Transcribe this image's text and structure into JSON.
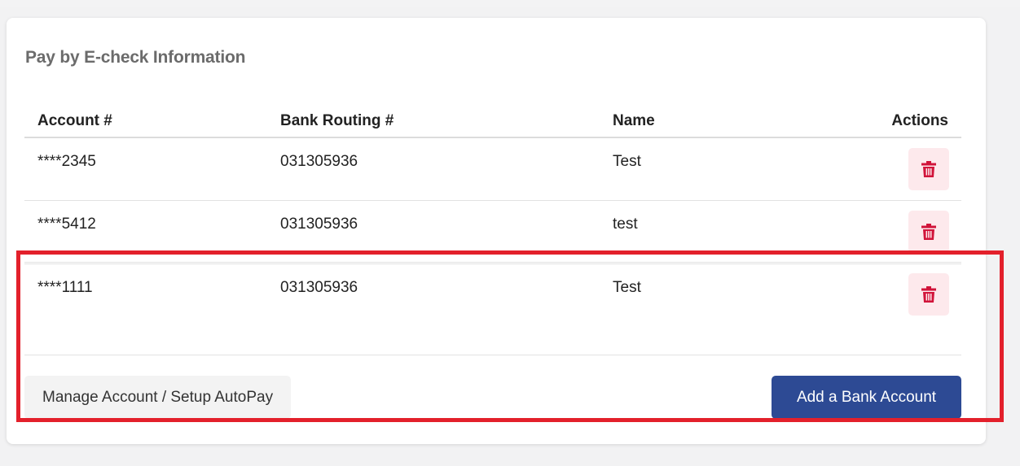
{
  "card": {
    "title": "Pay by E-check Information"
  },
  "table": {
    "headers": {
      "account": "Account #",
      "routing": "Bank Routing #",
      "name": "Name",
      "actions": "Actions"
    },
    "rows": [
      {
        "account": "****2345",
        "routing": "031305936",
        "name": "Test"
      },
      {
        "account": "****5412",
        "routing": "031305936",
        "name": "test"
      },
      {
        "account": "****1111",
        "routing": "031305936",
        "name": "Test"
      }
    ]
  },
  "footer": {
    "manage_label": "Manage Account / Setup AutoPay",
    "add_label": "Add a Bank Account"
  },
  "icons": {
    "delete": "trash-icon"
  },
  "colors": {
    "primary_button": "#2d4a94",
    "delete_icon": "#d1143a",
    "delete_bg": "#fde9ec",
    "highlight": "#e3202b"
  }
}
